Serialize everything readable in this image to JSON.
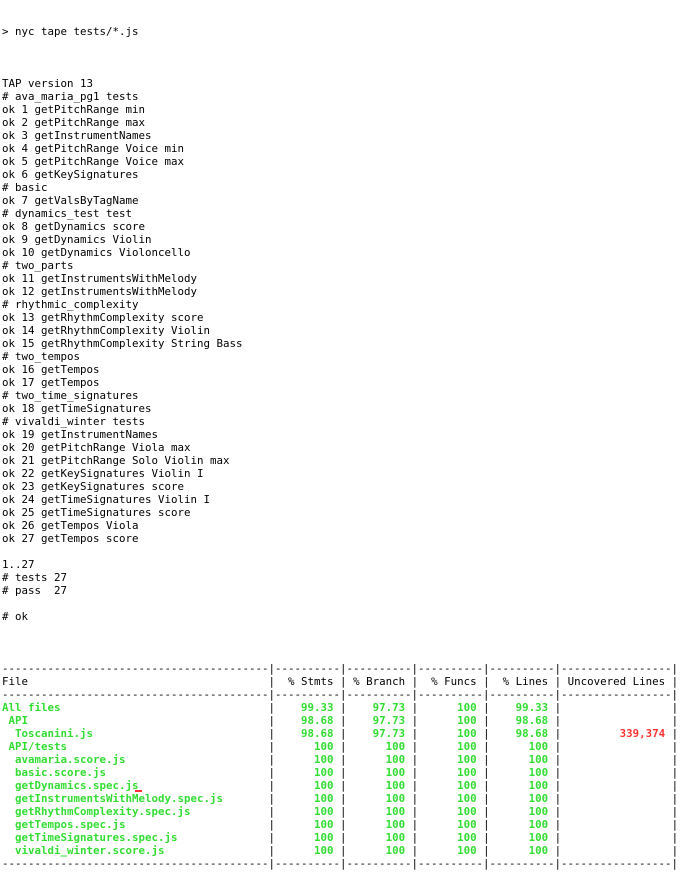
{
  "command": "> nyc tape tests/*.js",
  "tap_output": [
    "",
    "TAP version 13",
    "# ava_maria_pg1 tests",
    "ok 1 getPitchRange min",
    "ok 2 getPitchRange max",
    "ok 3 getInstrumentNames",
    "ok 4 getPitchRange Voice min",
    "ok 5 getPitchRange Voice max",
    "ok 6 getKeySignatures",
    "# basic",
    "ok 7 getValsByTagName",
    "# dynamics_test test",
    "ok 8 getDynamics score",
    "ok 9 getDynamics Violin",
    "ok 10 getDynamics Violoncello",
    "# two_parts",
    "ok 11 getInstrumentsWithMelody",
    "ok 12 getInstrumentsWithMelody",
    "# rhythmic_complexity",
    "ok 13 getRhythmComplexity score",
    "ok 14 getRhythmComplexity Violin",
    "ok 15 getRhythmComplexity String Bass",
    "# two_tempos",
    "ok 16 getTempos",
    "ok 17 getTempos",
    "# two_time_signatures",
    "ok 18 getTimeSignatures",
    "# vivaldi_winter tests",
    "ok 19 getInstrumentNames",
    "ok 20 getPitchRange Viola max",
    "ok 21 getPitchRange Solo Violin max",
    "ok 22 getKeySignatures Violin I",
    "ok 23 getKeySignatures score",
    "ok 24 getTimeSignatures Violin I",
    "ok 25 getTimeSignatures score",
    "ok 26 getTempos Viola",
    "ok 27 getTempos score",
    "",
    "1..27",
    "# tests 27",
    "# pass  27",
    "",
    "# ok",
    ""
  ],
  "coverage": {
    "separator": "-----------------------------------------|----------|----------|----------|----------|-----------------|",
    "header": [
      "File",
      "% Stmts",
      "% Branch",
      "% Funcs",
      "% Lines",
      "Uncovered Lines"
    ],
    "rows": [
      {
        "file": "All files",
        "stmts": "99.33",
        "branch": "97.73",
        "funcs": "100",
        "lines": "99.33",
        "uncovered": ""
      },
      {
        "file": " API",
        "stmts": "98.68",
        "branch": "97.73",
        "funcs": "100",
        "lines": "98.68",
        "uncovered": ""
      },
      {
        "file": "  Toscanini.js",
        "stmts": "98.68",
        "branch": "97.73",
        "funcs": "100",
        "lines": "98.68",
        "uncovered": "339,374"
      },
      {
        "file": " API/tests",
        "stmts": "100",
        "branch": "100",
        "funcs": "100",
        "lines": "100",
        "uncovered": ""
      },
      {
        "file": "  avamaria.score.js",
        "stmts": "100",
        "branch": "100",
        "funcs": "100",
        "lines": "100",
        "uncovered": ""
      },
      {
        "file": "  basic.score.js",
        "stmts": "100",
        "branch": "100",
        "funcs": "100",
        "lines": "100",
        "uncovered": ""
      },
      {
        "file": "  getDynamics.spec.js",
        "stmts": "100",
        "branch": "100",
        "funcs": "100",
        "lines": "100",
        "uncovered": ""
      },
      {
        "file": "  getInstrumentsWithMelody.spec.js",
        "stmts": "100",
        "branch": "100",
        "funcs": "100",
        "lines": "100",
        "uncovered": ""
      },
      {
        "file": "  getRhythmComplexity.spec.js",
        "stmts": "100",
        "branch": "100",
        "funcs": "100",
        "lines": "100",
        "uncovered": ""
      },
      {
        "file": "  getTempos.spec.js",
        "stmts": "100",
        "branch": "100",
        "funcs": "100",
        "lines": "100",
        "uncovered": ""
      },
      {
        "file": "  getTimeSignatures.spec.js",
        "stmts": "100",
        "branch": "100",
        "funcs": "100",
        "lines": "100",
        "uncovered": ""
      },
      {
        "file": "  vivaldi_winter.score.js",
        "stmts": "100",
        "branch": "100",
        "funcs": "100",
        "lines": "100",
        "uncovered": ""
      }
    ]
  },
  "colors": {
    "ok_green": "#33dd33",
    "uncovered_red": "#ff3333"
  }
}
